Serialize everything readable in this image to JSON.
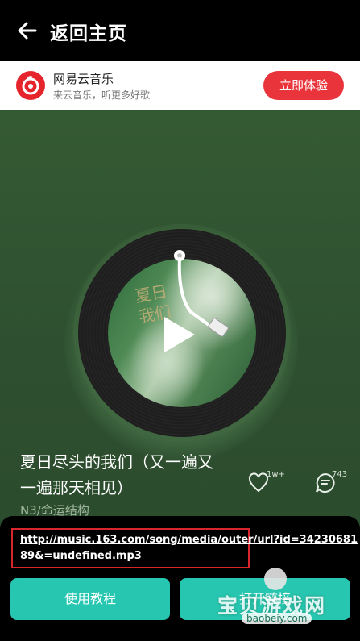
{
  "header": {
    "back_icon": "arrow-left-icon",
    "title": "返回主页"
  },
  "banner": {
    "logo_icon": "netease-cloud-music-icon",
    "title": "网易云音乐",
    "subtitle": "来云音乐，听更多好歌",
    "button_label": "立即体验",
    "accent": "#e9343c"
  },
  "player": {
    "cover_text": "夏日\n我们",
    "song_title": "夏日尽头的我们（又一遍又一遍那天相见）",
    "artist": "N3/命运结构",
    "like_count": "1w+",
    "comment_count": "743",
    "play_icon": "play-icon"
  },
  "bottom": {
    "url": "http://music.163.com/song/media/outer/url?id=3423068189&=undefined.mp3",
    "tutorial_label": "使用教程",
    "open_label": "打开链接",
    "button_color": "#26c6b0"
  },
  "watermark": {
    "title": "宝贝游戏网",
    "url": "baobeiy.com"
  }
}
